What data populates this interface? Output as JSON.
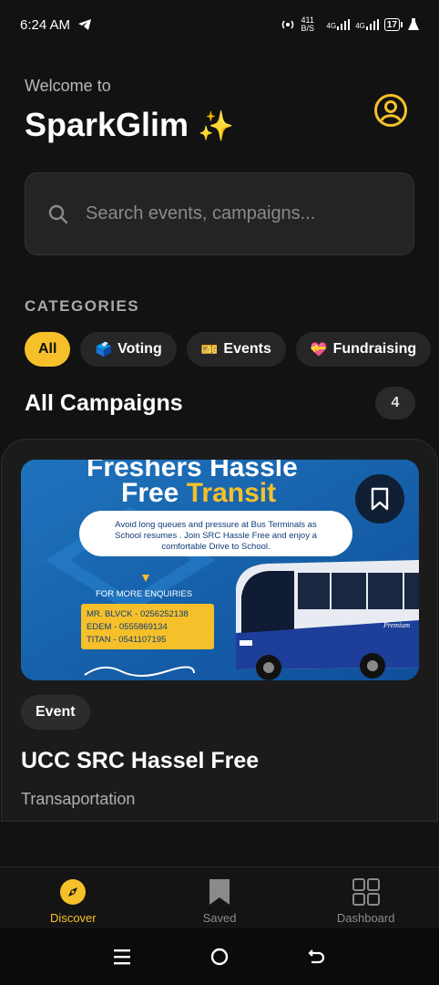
{
  "status_bar": {
    "time": "6:24 AM",
    "network_speed": "411 B/S",
    "signal1": "4G",
    "signal2": "4G",
    "battery": "17"
  },
  "header": {
    "welcome": "Welcome to",
    "app_name": "SparkGlim",
    "app_emoji": "✨"
  },
  "search": {
    "placeholder": "Search events, campaigns..."
  },
  "categories": {
    "label": "CATEGORIES",
    "items": [
      {
        "emoji": "",
        "label": "All"
      },
      {
        "emoji": "🗳️",
        "label": "Voting"
      },
      {
        "emoji": "🎫",
        "label": "Events"
      },
      {
        "emoji": "💝",
        "label": "Fundraising"
      }
    ]
  },
  "campaigns": {
    "title": "All Campaigns",
    "count": "4"
  },
  "card": {
    "banner": {
      "line1": "Freshers Hassle",
      "line2a": "Free ",
      "line2b": "Transit",
      "desc1": "Avoid long queues and pressure at Bus Terminals as",
      "desc2": "School resumes . Join SRC Hassle Free and enjoy a",
      "desc3": "comfortable Drive to School.",
      "enquiries": "FOR MORE ENQUIRIES",
      "contact1": "MR. BLVCK - 0256252138",
      "contact2": "EDEM - 0555869134",
      "contact3": "TITAN - 0541107195",
      "bus_brand": "Premium"
    },
    "tag": "Event",
    "title": "UCC SRC Hassel Free",
    "subtitle": "Transaportation"
  },
  "bottom_nav": {
    "items": [
      {
        "label": "Discover"
      },
      {
        "label": "Saved"
      },
      {
        "label": "Dashboard"
      }
    ]
  },
  "colors": {
    "accent": "#F5C02A",
    "background": "#121212",
    "card": "#1b1b1b"
  }
}
